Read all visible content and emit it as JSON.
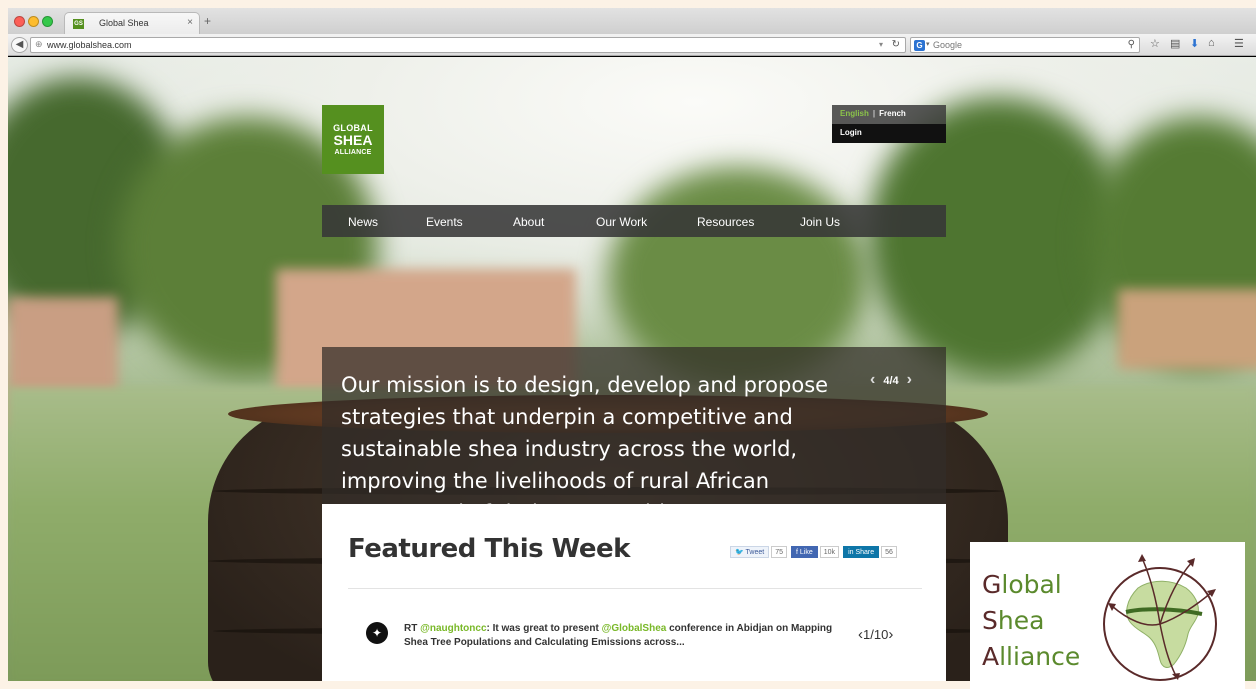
{
  "browser": {
    "tab_title": "Global Shea",
    "tab_close": "×",
    "new_tab": "+",
    "favicon_text": "GS",
    "url": "www.globalshea.com",
    "search_engine": "G",
    "search_placeholder": "Google"
  },
  "site": {
    "logo": {
      "line1": "GLOBAL",
      "line2": "SHEA",
      "line3": "ALLIANCE"
    },
    "language": {
      "active": "English",
      "separator": "|",
      "other": "French"
    },
    "login": "Login",
    "nav": [
      "News",
      "Events",
      "About",
      "Our Work",
      "Resources",
      "Join Us"
    ],
    "mission": {
      "text": "Our mission is to design, develop and propose strategies that underpin a competitive and sustainable shea industry across the world, improving the livelihoods of rural African women and of their communities.",
      "pager": "4/4"
    },
    "featured": {
      "title": "Featured This Week",
      "share": {
        "tweet_label": "Tweet",
        "tweet_count": "75",
        "like_label": "Like",
        "like_count": "10k",
        "share_label": "Share",
        "share_count": "56"
      },
      "tweet": {
        "prefix": "RT ",
        "handle": "@naughtoncc",
        "part1": ": It was great to present ",
        "mention": "@GlobalShea",
        "part2": " conference in Abidjan on Mapping Shea Tree Populations and Calculating Emissions across...",
        "pager": "1/10"
      }
    }
  },
  "brand_overlay": {
    "line1_first": "G",
    "line1_rest": "lobal",
    "line2_first": "S",
    "line2_rest": "hea",
    "line3_first": "A",
    "line3_rest": "lliance"
  },
  "colors": {
    "brand_green": "#55901f",
    "accent_green": "#79b828",
    "brand_maroon": "#5a2a2a"
  }
}
